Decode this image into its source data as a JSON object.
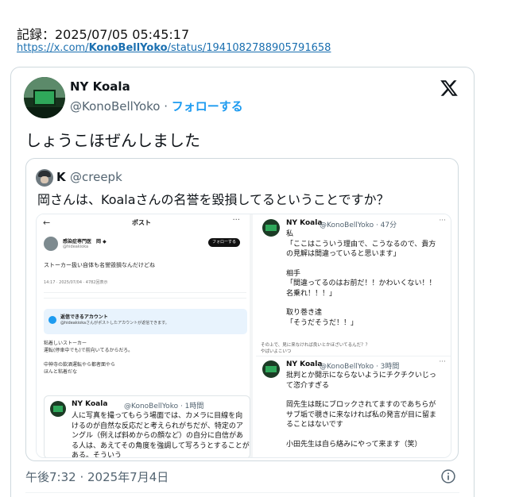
{
  "record": {
    "label": "記録：2025/07/05 05:45:17",
    "url_prefix": "https://x.com/",
    "url_bold": "KonoBellYoko",
    "url_suffix": "/status/1941082788905791658"
  },
  "tweet": {
    "author_name": "NY Koala",
    "author_handle": "@KonoBellYoko",
    "separator": " · ",
    "follow_label": "フォローする",
    "text": "しょうこほぜんしました",
    "timestamp": "午後7:32 · 2025年7月4日",
    "logo_icon": "x-logo-icon",
    "info_icon": "info-icon"
  },
  "quote": {
    "author_name": "K",
    "author_handle": "@creepk",
    "text": "岡さんは、Koalaさんの名誉を毀損してるということですか？"
  },
  "screenshot_left": {
    "back": "←",
    "title": "ポスト",
    "dots": "···",
    "account_name": "感染症専門医　岡 ◆",
    "account_handle": "@hideakioka",
    "follow_button": "フォローする",
    "post_text": "ストーカー扱い自体も名誉毀損なんだけどね",
    "stats": "14:17 · 2025/07/04 · 4782回表示",
    "notice_title": "返信できるアカウント",
    "notice_text": "@hideakiokaさんがポストしたアカウントが返信できます。",
    "lines": [
      "粘着しいストーカー",
      "運転(停車中でも)で前向いてるからだろ。",
      "",
      "中神寺の飲酒運転やら都者面やら",
      "ほんと粘着だな"
    ],
    "inner_author": "NY Koala",
    "inner_meta": "@KonoBellYoko · 1時間",
    "inner_text": "人に写真を撮ってもらう場面では、カメラに目線を向けるのが自然な反応だと考えられがちだが、特定のアングル（例えば斜めからの顔など）の自分に自信がある人は、あえてその角度を強調して写ろうとすることがある。そういう"
  },
  "screenshot_right": {
    "post1_author": "NY Koala",
    "post1_meta": "@KonoBellYoko · 47分",
    "dots": "···",
    "post1_lines": [
      "私",
      "「ここはこういう理由で、こうなるので、貴方",
      "の見解は間違っていると思います」",
      "",
      "相手",
      "「間違ってるのはお前だ！！かわいくない！！",
      "名乗れ！！！」",
      "",
      "取り巻き達",
      "「そうだそうだ！！」"
    ],
    "note_lines": [
      "その上で、見に来なければ良いとかほざいてるんだ？？",
      "やばいよこいつ"
    ],
    "post2_author": "NY Koala",
    "post2_meta": "@KonoBellYoko · 3時間",
    "post2_lines": [
      "批判とか開示にならないようにチクチクいじっ",
      "て恣介すぎる",
      "",
      "岡先生は既にブロックされてますのであちらが",
      "サブ垢で覗きに来なければ私の発言が目に留ま",
      "ることはないです",
      "",
      "小田先生は自ら絡みにやって来ます（笑）"
    ]
  },
  "colors": {
    "link": "#1a6fb0",
    "follow": "#1d9bf0",
    "muted": "#536471",
    "border": "#cfd9de"
  }
}
